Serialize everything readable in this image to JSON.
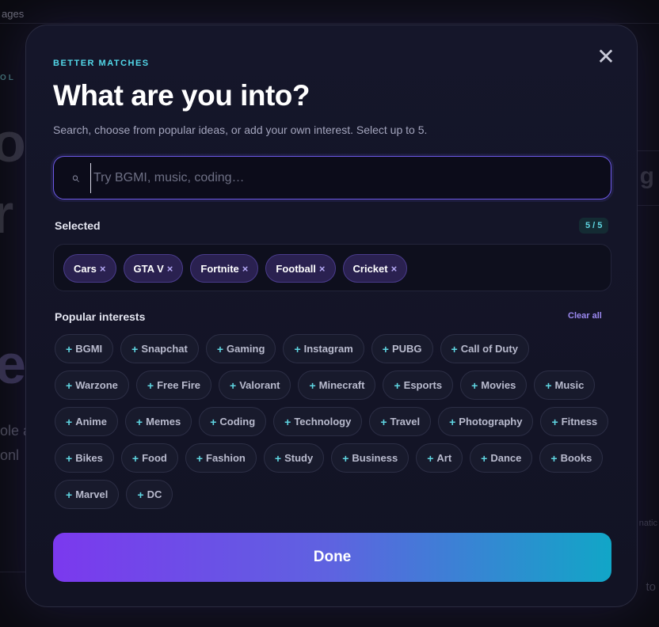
{
  "background": {
    "topbar_text": "ages",
    "eyebrow": "OL",
    "big1": "o",
    "big2": "r",
    "big3": "e",
    "small1": "ole a",
    "small2": "onl",
    "right_letter": "g",
    "right_text1": "natic",
    "right_text2": "to"
  },
  "modal": {
    "eyebrow": "BETTER MATCHES",
    "title": "What are you into?",
    "subtitle": "Search, choose from popular ideas, or add your own interest. Select up to 5.",
    "close_glyph": "✕",
    "search": {
      "icon": "search-icon",
      "placeholder": "Try BGMI, music, coding…",
      "value": ""
    },
    "selected": {
      "label": "Selected",
      "counter": "5 / 5",
      "chips": [
        "Cars",
        "GTA V",
        "Fortnite",
        "Football",
        "Cricket"
      ],
      "remove_glyph": "×"
    },
    "popular": {
      "label": "Popular interests",
      "clear_all": "Clear all",
      "add_glyph": "+",
      "chips": [
        "BGMI",
        "Snapchat",
        "Gaming",
        "Instagram",
        "PUBG",
        "Call of Duty",
        "Warzone",
        "Free Fire",
        "Valorant",
        "Minecraft",
        "Esports",
        "Movies",
        "Music",
        "Anime",
        "Memes",
        "Coding",
        "Technology",
        "Travel",
        "Photography",
        "Fitness",
        "Bikes",
        "Food",
        "Fashion",
        "Study",
        "Business",
        "Art",
        "Dance",
        "Books",
        "Marvel",
        "DC"
      ]
    },
    "done_label": "Done"
  },
  "colors": {
    "accent_cyan": "#53d9ea",
    "accent_purple": "#7b39ee",
    "modal_bg": "#15162a"
  }
}
